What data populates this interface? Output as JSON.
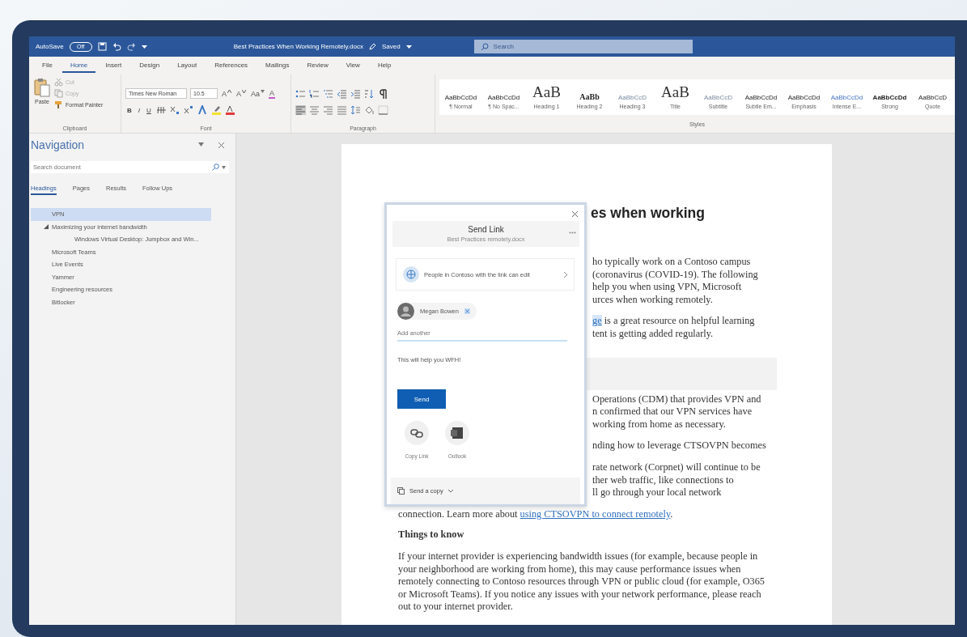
{
  "titlebar": {
    "autosave": {
      "label": "AutoSave",
      "state": "Off",
      "on": false
    },
    "title": "Best Practices When Working Remotely.docx",
    "status": "Saved",
    "search": {
      "placeholder": "Search"
    }
  },
  "ribbon_tabs": [
    {
      "label": "File",
      "selected": false
    },
    {
      "label": "Home",
      "selected": true
    },
    {
      "label": "Insert",
      "selected": false
    },
    {
      "label": "Design",
      "selected": false
    },
    {
      "label": "Layout",
      "selected": false
    },
    {
      "label": "References",
      "selected": false
    },
    {
      "label": "Mailings",
      "selected": false
    },
    {
      "label": "Review",
      "selected": false
    },
    {
      "label": "View",
      "selected": false
    },
    {
      "label": "Help",
      "selected": false
    }
  ],
  "ribbon": {
    "clipboard": {
      "paste": "Paste",
      "items": [
        {
          "label": "Cut",
          "disabled": true
        },
        {
          "label": "Copy",
          "disabled": true
        },
        {
          "label": "Format Painter",
          "disabled": false
        }
      ],
      "group_label": "Clipboard"
    },
    "font": {
      "name": "Times New Roman",
      "size": "10.5",
      "tool_buttons": [
        {
          "label": "A",
          "kind": "grow"
        },
        {
          "label": "A",
          "kind": "shrink"
        },
        {
          "label": "Aa",
          "kind": "case"
        },
        {
          "label": "A",
          "kind": "clear"
        }
      ],
      "format_buttons": [
        "B",
        "I",
        "U"
      ],
      "group_label": "Font"
    },
    "paragraph": {
      "group_label": "Paragraph"
    },
    "styles": {
      "items": [
        {
          "preview": "AaBbCcDd",
          "name": "¶ Normal",
          "kind": "body"
        },
        {
          "preview": "AaBbCcDd",
          "name": "¶ No Spac...",
          "kind": "body"
        },
        {
          "preview": "AaB",
          "name": "Heading 1",
          "kind": "big"
        },
        {
          "preview": "AaBb",
          "name": "Heading 2",
          "kind": "heading"
        },
        {
          "preview": "AaBbCcD",
          "name": "Heading 3",
          "kind": "light"
        },
        {
          "preview": "AaB",
          "name": "Title",
          "kind": "big"
        },
        {
          "preview": "AaBbCcD",
          "name": "Subtitle",
          "kind": "light"
        },
        {
          "preview": "AaBbCcDd",
          "name": "Subtle Em...",
          "kind": "body"
        },
        {
          "preview": "AaBbCcDd",
          "name": "Emphasis",
          "kind": "body"
        },
        {
          "preview": "AaBbCcDd",
          "name": "Intense E...",
          "kind": "accent"
        },
        {
          "preview": "AaBbCcDd",
          "name": "Strong",
          "kind": "strong"
        },
        {
          "preview": "AaBbCcD",
          "name": "Quote",
          "kind": "body"
        }
      ],
      "group_label": "Styles"
    }
  },
  "navigation": {
    "title": "Navigation",
    "search": {
      "placeholder": "Search document"
    },
    "tabs": [
      {
        "label": "Headings",
        "selected": true
      },
      {
        "label": "Pages",
        "selected": false
      },
      {
        "label": "Results",
        "selected": false
      },
      {
        "label": "Follow Ups",
        "selected": false
      }
    ],
    "tree": [
      {
        "label": "VPN",
        "selected": true
      },
      {
        "label": "Maximizing your internet bandwidth",
        "selected": false,
        "expanded": true,
        "children": [
          {
            "label": "Windows Virtual Desktop: Jumpbox and Win...",
            "selected": false
          }
        ]
      },
      {
        "label": "Microsoft Teams",
        "selected": false
      },
      {
        "label": "Live Events",
        "selected": false
      },
      {
        "label": "Yammer",
        "selected": false
      },
      {
        "label": "Engineering resources",
        "selected": false
      },
      {
        "label": "Bitlocker",
        "selected": false
      }
    ]
  },
  "document": {
    "heading": "es when working",
    "blocks": [
      {
        "kind": "clipped",
        "lines": [
          "ho typically work on a Contoso campus",
          "(coronavirus (COVID-19). The following",
          "help you when using VPN, Microsoft",
          "urces when working remotely."
        ]
      },
      {
        "kind": "clipped",
        "lines": [
          {
            "link": "ge",
            "text": " is a great resource on helpful learning"
          },
          "tent is getting added regularly."
        ]
      },
      {
        "kind": "shaded"
      },
      {
        "kind": "clipped",
        "lines": [
          "Operations (CDM) that provides VPN and",
          "n confirmed that our VPN services have",
          "working from home as necessary."
        ]
      },
      {
        "kind": "clipped",
        "lines": [
          "nding how to leverage CTSOVPN becomes"
        ]
      },
      {
        "kind": "clipped",
        "lines": [
          "rate network (Corpnet) will continue to be",
          "ther web traffic, like connections to",
          "ll go through your local network"
        ]
      },
      {
        "kind": "linked",
        "before": "connection. Learn more about ",
        "link": "using CTSOVPN to connect remotely",
        "after": "."
      },
      {
        "kind": "subheading",
        "text": "Things to know"
      },
      {
        "kind": "paragraph",
        "text": "If your internet provider is experiencing bandwidth issues (for example, because people in your neighborhood are working from home), this may cause performance issues when remotely connecting to Contoso resources through VPN or public cloud (for example, O365 or Microsoft Teams). If you notice any issues with your network performance, please reach out to your internet provider."
      }
    ]
  },
  "share_dialog": {
    "title": "Send Link",
    "subtitle": "Best Practices remotely.docx",
    "permission": "People in Contoso with the link can edit",
    "recipient": "Megan Bowen",
    "add_placeholder": "Add another",
    "message": "This will help you WFH!",
    "send": "Send",
    "options": [
      {
        "label": "Copy Link",
        "kind": "link"
      },
      {
        "label": "Outlook",
        "kind": "outlook"
      }
    ],
    "footer": "Send a copy"
  }
}
